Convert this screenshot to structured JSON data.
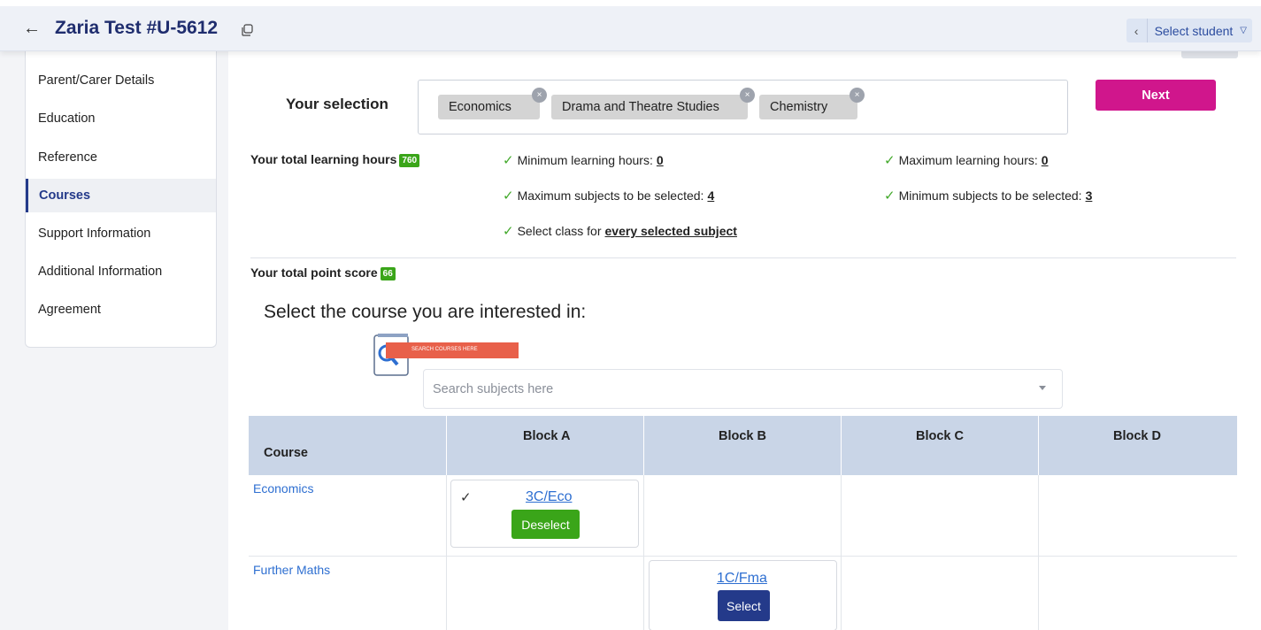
{
  "header": {
    "title": "Zaria Test #U-5612",
    "select_student": "Select student"
  },
  "sidebar": {
    "items": [
      {
        "label": "Parent/Carer Details"
      },
      {
        "label": "Education"
      },
      {
        "label": "Reference"
      },
      {
        "label": "Courses",
        "active": true
      },
      {
        "label": "Support Information"
      },
      {
        "label": "Additional Information"
      },
      {
        "label": "Agreement"
      }
    ]
  },
  "selection": {
    "label": "Your selection",
    "chips": [
      "Economics",
      "Drama and Theatre Studies",
      "Chemistry"
    ],
    "next_label": "Next"
  },
  "summary": {
    "hours_label": "Your total learning hours",
    "hours_value": "760",
    "points_label": "Your total point score",
    "points_value": "66",
    "requirements": [
      {
        "text": "Minimum learning hours:",
        "value": "0"
      },
      {
        "text": "Maximum learning hours:",
        "value": "0"
      },
      {
        "text": "Maximum subjects to be selected:",
        "value": "4"
      },
      {
        "text": "Minimum subjects to be selected:",
        "value": "3"
      },
      {
        "text": "Select class for",
        "value": "every selected subject"
      }
    ]
  },
  "courses_section": {
    "title": "Select the course you are interested in:",
    "search_banner": "SEARCH COURSES HERE",
    "search_placeholder": "Search subjects here"
  },
  "table": {
    "headers": [
      "Course",
      "Block A",
      "Block B",
      "Block C",
      "Block D"
    ],
    "rows": [
      {
        "course": "Economics",
        "option_code": "3C/Eco",
        "option_action": "Deselect",
        "block": "A",
        "selected": true
      },
      {
        "course": "Further Maths",
        "option_code": "1C/Fma",
        "option_action": "Select",
        "block": "B",
        "selected": false
      }
    ]
  },
  "colors": {
    "primary_navy": "#243a8a",
    "next_button": "#d0168c",
    "success_green": "#3aa519",
    "table_header": "#c9d5e7"
  }
}
